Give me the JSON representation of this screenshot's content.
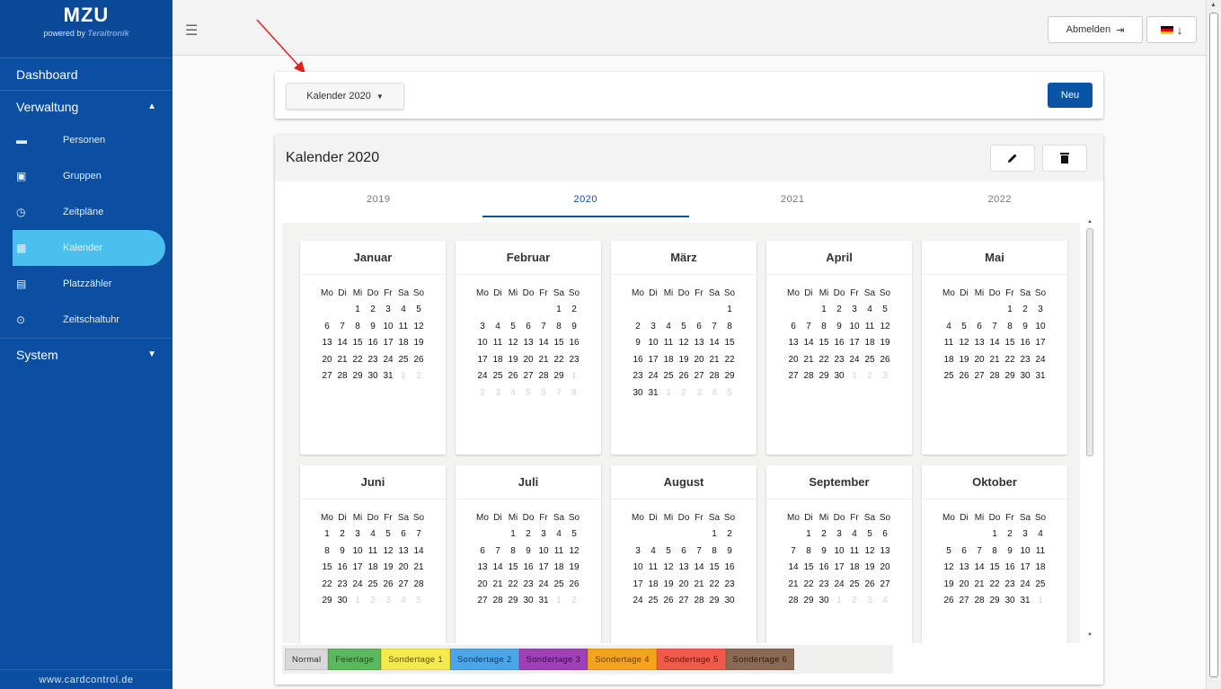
{
  "sidebar": {
    "brand_title": "MZU",
    "powered_by": "powered by",
    "powered_logo": "Teraitronik",
    "dashboard": "Dashboard",
    "verwaltung": "Verwaltung",
    "items": [
      {
        "label": "Personen",
        "icon": "persons-icon"
      },
      {
        "label": "Gruppen",
        "icon": "groups-icon"
      },
      {
        "label": "Zeitpläne",
        "icon": "clock-icon"
      },
      {
        "label": "Kalender",
        "icon": "calendar-icon"
      },
      {
        "label": "Platzzähler",
        "icon": "counter-icon"
      },
      {
        "label": "Zeitschaltuhr",
        "icon": "timer-icon"
      }
    ],
    "system": "System",
    "footer": "www.cardcontrol.de"
  },
  "topbar": {
    "logout_label": "Abmelden",
    "logout_icon": "logout-icon",
    "lang_icon": "german-flag-icon"
  },
  "toolbar": {
    "calendar_select": "Kalender 2020",
    "new_label": "Neu"
  },
  "calendar": {
    "title": "Kalender 2020",
    "years": [
      "2019",
      "2020",
      "2021",
      "2022"
    ],
    "active_year": "2020",
    "weekdays": [
      "Mo",
      "Di",
      "Mi",
      "Do",
      "Fr",
      "Sa",
      "So"
    ],
    "months": [
      {
        "name": "Januar",
        "weeks": [
          [
            "",
            "",
            "1",
            "2",
            "3",
            "4",
            "5"
          ],
          [
            "6",
            "7",
            "8",
            "9",
            "10",
            "11",
            "12"
          ],
          [
            "13",
            "14",
            "15",
            "16",
            "17",
            "18",
            "19"
          ],
          [
            "20",
            "21",
            "22",
            "23",
            "24",
            "25",
            "26"
          ],
          [
            "27",
            "28",
            "29",
            "30",
            "31",
            "*1",
            "*2"
          ]
        ]
      },
      {
        "name": "Februar",
        "weeks": [
          [
            "",
            "",
            "",
            "",
            "",
            "1",
            "2"
          ],
          [
            "3",
            "4",
            "5",
            "6",
            "7",
            "8",
            "9"
          ],
          [
            "10",
            "11",
            "12",
            "13",
            "14",
            "15",
            "16"
          ],
          [
            "17",
            "18",
            "19",
            "20",
            "21",
            "22",
            "23"
          ],
          [
            "24",
            "25",
            "26",
            "27",
            "28",
            "29",
            "*1"
          ],
          [
            "*2",
            "*3",
            "*4",
            "*5",
            "*6",
            "*7",
            "*8"
          ]
        ]
      },
      {
        "name": "März",
        "weeks": [
          [
            "",
            "",
            "",
            "",
            "",
            "",
            "1"
          ],
          [
            "2",
            "3",
            "4",
            "5",
            "6",
            "7",
            "8"
          ],
          [
            "9",
            "10",
            "11",
            "12",
            "13",
            "14",
            "15"
          ],
          [
            "16",
            "17",
            "18",
            "19",
            "20",
            "21",
            "22"
          ],
          [
            "23",
            "24",
            "25",
            "26",
            "27",
            "28",
            "29"
          ],
          [
            "30",
            "31",
            "*1",
            "*2",
            "*3",
            "*4",
            "*5"
          ]
        ]
      },
      {
        "name": "April",
        "weeks": [
          [
            "",
            "",
            "1",
            "2",
            "3",
            "4",
            "5"
          ],
          [
            "6",
            "7",
            "8",
            "9",
            "10",
            "11",
            "12"
          ],
          [
            "13",
            "14",
            "15",
            "16",
            "17",
            "18",
            "19"
          ],
          [
            "20",
            "21",
            "22",
            "23",
            "24",
            "25",
            "26"
          ],
          [
            "27",
            "28",
            "29",
            "30",
            "*1",
            "*2",
            "*3"
          ]
        ]
      },
      {
        "name": "Mai",
        "weeks": [
          [
            "",
            "",
            "",
            "",
            "1",
            "2",
            "3"
          ],
          [
            "4",
            "5",
            "6",
            "7",
            "8",
            "9",
            "10"
          ],
          [
            "11",
            "12",
            "13",
            "14",
            "15",
            "16",
            "17"
          ],
          [
            "18",
            "19",
            "20",
            "21",
            "22",
            "23",
            "24"
          ],
          [
            "25",
            "26",
            "27",
            "28",
            "29",
            "30",
            "31"
          ]
        ]
      },
      {
        "name": "Juni",
        "weeks": [
          [
            "1",
            "2",
            "3",
            "4",
            "5",
            "6",
            "7"
          ],
          [
            "8",
            "9",
            "10",
            "11",
            "12",
            "13",
            "14"
          ],
          [
            "15",
            "16",
            "17",
            "18",
            "19",
            "20",
            "21"
          ],
          [
            "22",
            "23",
            "24",
            "25",
            "26",
            "27",
            "28"
          ],
          [
            "29",
            "30",
            "*1",
            "*2",
            "*3",
            "*4",
            "*5"
          ]
        ]
      },
      {
        "name": "Juli",
        "weeks": [
          [
            "",
            "",
            "1",
            "2",
            "3",
            "4",
            "5"
          ],
          [
            "6",
            "7",
            "8",
            "9",
            "10",
            "11",
            "12"
          ],
          [
            "13",
            "14",
            "15",
            "16",
            "17",
            "18",
            "19"
          ],
          [
            "20",
            "21",
            "22",
            "23",
            "24",
            "25",
            "26"
          ],
          [
            "27",
            "28",
            "29",
            "30",
            "31",
            "*1",
            "*2"
          ]
        ]
      },
      {
        "name": "August",
        "weeks": [
          [
            "",
            "",
            "",
            "",
            "",
            "1",
            "2"
          ],
          [
            "3",
            "4",
            "5",
            "6",
            "7",
            "8",
            "9"
          ],
          [
            "10",
            "11",
            "12",
            "13",
            "14",
            "15",
            "16"
          ],
          [
            "17",
            "18",
            "19",
            "20",
            "21",
            "22",
            "23"
          ],
          [
            "24",
            "25",
            "26",
            "27",
            "28",
            "29",
            "30"
          ]
        ]
      },
      {
        "name": "September",
        "weeks": [
          [
            "",
            "1",
            "2",
            "3",
            "4",
            "5",
            "6"
          ],
          [
            "7",
            "8",
            "9",
            "10",
            "11",
            "12",
            "13"
          ],
          [
            "14",
            "15",
            "16",
            "17",
            "18",
            "19",
            "20"
          ],
          [
            "21",
            "22",
            "23",
            "24",
            "25",
            "26",
            "27"
          ],
          [
            "28",
            "29",
            "30",
            "*1",
            "*2",
            "*3",
            "*4"
          ]
        ]
      },
      {
        "name": "Oktober",
        "weeks": [
          [
            "",
            "",
            "",
            "1",
            "2",
            "3",
            "4"
          ],
          [
            "5",
            "6",
            "7",
            "8",
            "9",
            "10",
            "11"
          ],
          [
            "12",
            "13",
            "14",
            "15",
            "16",
            "17",
            "18"
          ],
          [
            "19",
            "20",
            "21",
            "22",
            "23",
            "24",
            "25"
          ],
          [
            "26",
            "27",
            "28",
            "29",
            "30",
            "31",
            "*1"
          ]
        ]
      }
    ]
  },
  "legend": [
    {
      "label": "Normal",
      "color": "#d9d9d9",
      "text_color": "#333333"
    },
    {
      "label": "Feiertage",
      "color": "#5cb85c",
      "text_color": "#1f4d1f"
    },
    {
      "label": "Sondertage 1",
      "color": "#f4ea4d",
      "text_color": "#5a5200"
    },
    {
      "label": "Sondertage 2",
      "color": "#4aa6e8",
      "text_color": "#0d3b66"
    },
    {
      "label": "Sondertage 3",
      "color": "#a040b8",
      "text_color": "#3a0b46"
    },
    {
      "label": "Sondertage 4",
      "color": "#f5a21f",
      "text_color": "#6b3c00"
    },
    {
      "label": "Sondertage 5",
      "color": "#ef5a4a",
      "text_color": "#6b130b"
    },
    {
      "label": "Sondertage 6",
      "color": "#8a6a55",
      "text_color": "#2e1e14"
    }
  ],
  "colors": {
    "sidebar_bg": "#0b4fa2",
    "sidebar_active": "#4bc0ee",
    "primary": "#0a54a6"
  }
}
